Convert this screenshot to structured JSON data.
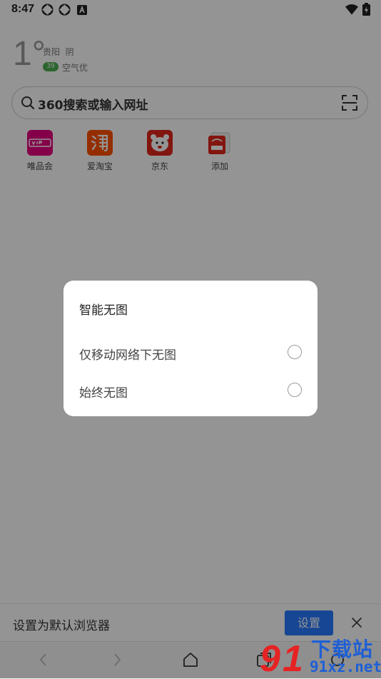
{
  "status_bar": {
    "time": "8:47",
    "icons": [
      "sync-icon",
      "sync-icon",
      "font-a-icon",
      "wifi-icon",
      "battery-charging-icon"
    ]
  },
  "weather": {
    "temperature": "1°",
    "city": "贵阳",
    "condition": "阴",
    "aqi_value": "39",
    "aqi_label": "空气优"
  },
  "search": {
    "placeholder": "360搜索或输入网址"
  },
  "shortcuts": [
    {
      "label": "唯品会",
      "icon": "vip-logo-icon",
      "color": "#e4007f"
    },
    {
      "label": "爱淘宝",
      "icon": "taobao-logo-icon",
      "color": "#ff5000"
    },
    {
      "label": "京东",
      "icon": "jd-logo-icon",
      "color": "#e1251b"
    },
    {
      "label": "添加",
      "icon": "add-shortcut-icon",
      "color": "#e1251b"
    }
  ],
  "dialog": {
    "title": "智能无图",
    "options": [
      {
        "label": "仅移动网络下无图",
        "selected": false
      },
      {
        "label": "始终无图",
        "selected": false
      }
    ]
  },
  "default_browser_bar": {
    "text": "设置为默认浏览器",
    "button_label": "设置",
    "accent": "#2979ff"
  },
  "nav": {
    "icons": [
      "back-icon",
      "forward-icon",
      "home-icon",
      "tabs-icon",
      "menu-icon"
    ]
  },
  "watermark": {
    "title": "下载站",
    "url": "91xz.net"
  }
}
